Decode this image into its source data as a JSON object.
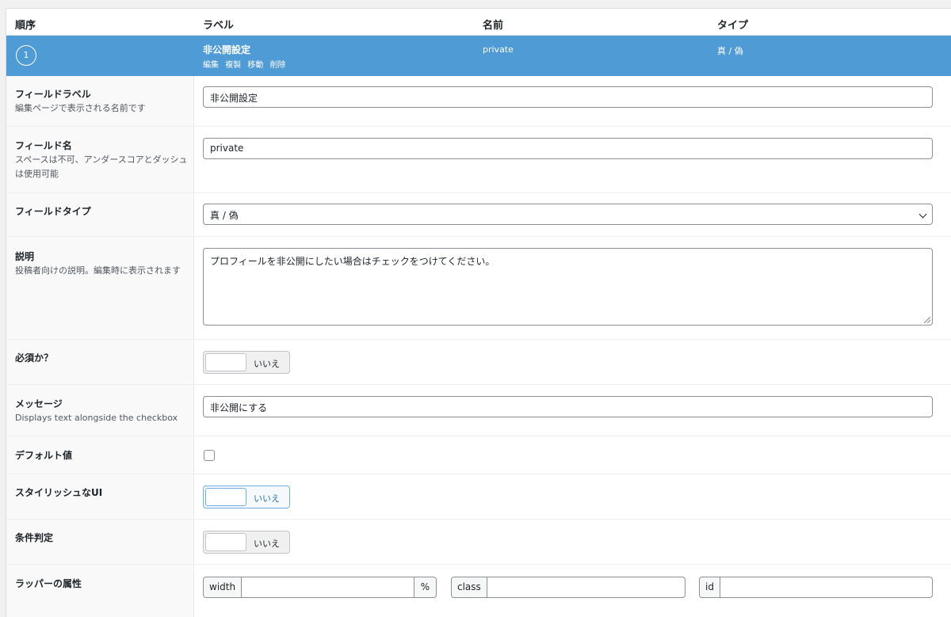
{
  "header": {
    "col_order": "順序",
    "col_label": "ラベル",
    "col_name": "名前",
    "col_type": "タイプ"
  },
  "field": {
    "order": "1",
    "label": "非公開設定",
    "actions": [
      "編集",
      "複製",
      "移動",
      "削除"
    ],
    "name": "private",
    "type": "真 / 偽"
  },
  "settings": {
    "field_label": {
      "title": "フィールドラベル",
      "desc": "編集ページで表示される名前です",
      "value": "非公開設定"
    },
    "field_name": {
      "title": "フィールド名",
      "desc": "スペースは不可、アンダースコアとダッシュは使用可能",
      "value": "private"
    },
    "field_type": {
      "title": "フィールドタイプ",
      "value": "真 / 偽"
    },
    "instructions": {
      "title": "説明",
      "desc": "投稿者向けの説明。編集時に表示されます",
      "value": "プロフィールを非公開にしたい場合はチェックをつけてください。"
    },
    "required": {
      "title": "必須か？",
      "toggle": "いいえ"
    },
    "message": {
      "title": "メッセージ",
      "desc": "Displays text alongside the checkbox",
      "value": "非公開にする"
    },
    "default_value": {
      "title": "デフォルト値",
      "checked": false
    },
    "stylized_ui": {
      "title": "スタイリッシュなUI",
      "toggle": "いいえ"
    },
    "conditional_logic": {
      "title": "条件判定",
      "toggle": "いいえ"
    },
    "wrapper": {
      "title": "ラッパーの属性",
      "width_label": "width",
      "width_suffix": "%",
      "class_label": "class",
      "id_label": "id"
    }
  },
  "colors": {
    "accent": "#4f9bd6",
    "focus": "#72aee6"
  }
}
